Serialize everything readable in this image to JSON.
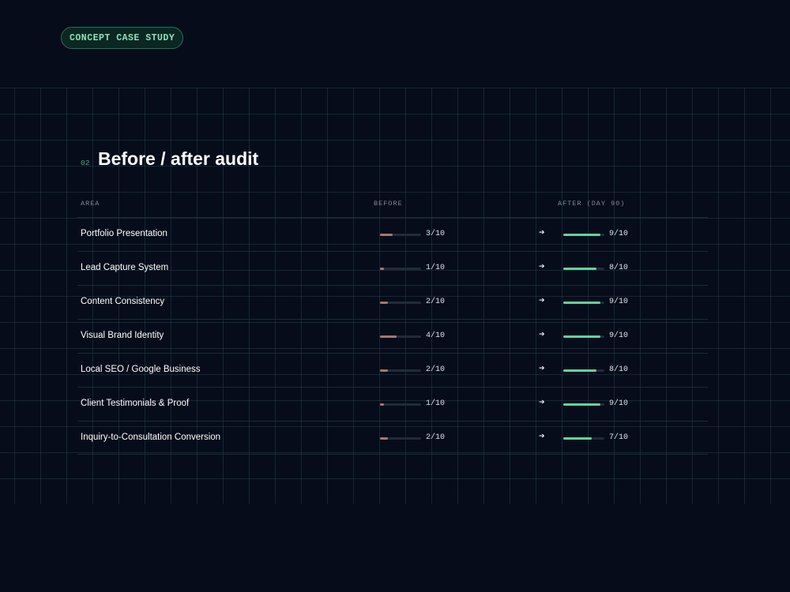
{
  "badge": "CONCEPT CASE STUDY",
  "section": {
    "number": "02",
    "title": "Before / after audit"
  },
  "columns": {
    "area": "AREA",
    "before": "BEFORE",
    "after": "AFTER (DAY 90)"
  },
  "arrow_glyph": "➔",
  "colors": {
    "background": "#060c1a",
    "accent": "#5fd4a3",
    "before_bar": "#a57676"
  },
  "rows": [
    {
      "area": "Portfolio Presentation",
      "before": "3/10",
      "before_value": 3,
      "after": "9/10",
      "after_value": 9
    },
    {
      "area": "Lead Capture System",
      "before": "1/10",
      "before_value": 1,
      "after": "8/10",
      "after_value": 8
    },
    {
      "area": "Content Consistency",
      "before": "2/10",
      "before_value": 2,
      "after": "9/10",
      "after_value": 9
    },
    {
      "area": "Visual Brand Identity",
      "before": "4/10",
      "before_value": 4,
      "after": "9/10",
      "after_value": 9
    },
    {
      "area": "Local SEO / Google Business",
      "before": "2/10",
      "before_value": 2,
      "after": "8/10",
      "after_value": 8
    },
    {
      "area": "Client Testimonials & Proof",
      "before": "1/10",
      "before_value": 1,
      "after": "9/10",
      "after_value": 9
    },
    {
      "area": "Inquiry-to-Consultation Conversion",
      "before": "2/10",
      "before_value": 2,
      "after": "7/10",
      "after_value": 7
    }
  ],
  "score_max": 10
}
